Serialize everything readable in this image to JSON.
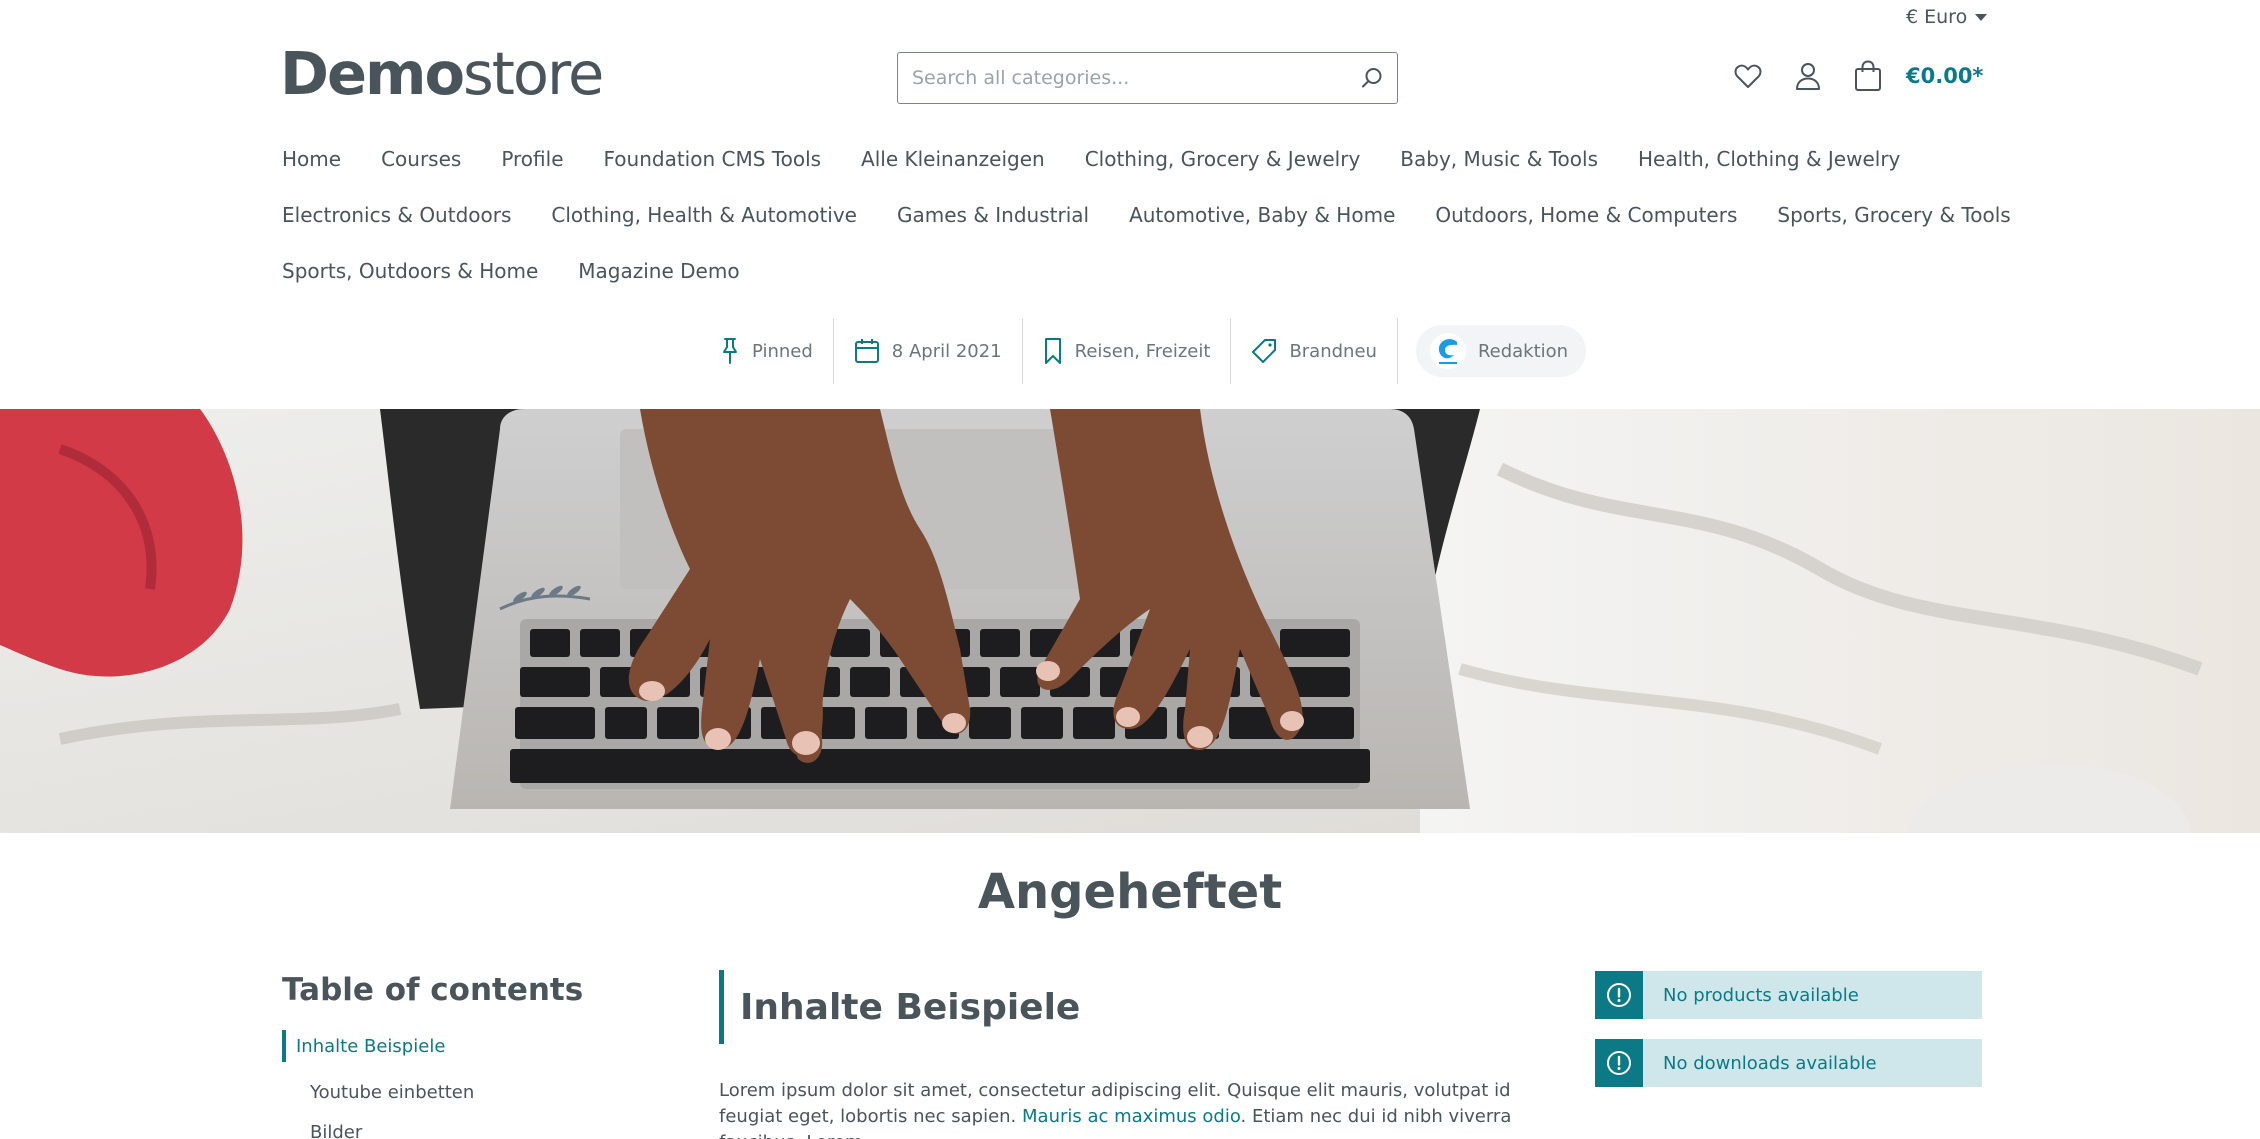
{
  "topbar": {
    "currency": "€ Euro"
  },
  "header": {
    "logo_bold": "Demo",
    "logo_light": "store",
    "search_placeholder": "Search all categories...",
    "cart_total": "€0.00*"
  },
  "nav": {
    "row1": [
      "Home",
      "Courses",
      "Profile",
      "Foundation CMS Tools",
      "Alle Kleinanzeigen",
      "Clothing, Grocery & Jewelry",
      "Baby, Music & Tools",
      "Health, Clothing & Jewelry"
    ],
    "row2": [
      "Electronics & Outdoors",
      "Clothing, Health & Automotive",
      "Games & Industrial",
      "Automotive, Baby & Home",
      "Outdoors, Home & Computers",
      "Sports, Grocery & Tools"
    ],
    "row3": [
      "Sports, Outdoors & Home",
      "Magazine Demo"
    ]
  },
  "meta": {
    "pinned": "Pinned",
    "date": "8 April 2021",
    "categories": "Reisen, Freizeit",
    "tag": "Brandneu",
    "author": "Redaktion"
  },
  "page_title": "Angeheftet",
  "toc": {
    "heading": "Table of contents",
    "items": [
      "Inhalte Beispiele",
      "Youtube einbetten",
      "Bilder"
    ]
  },
  "article": {
    "heading": "Inhalte Beispiele",
    "p_start": "Lorem ipsum dolor sit amet, consectetur adipiscing elit. Quisque elit mauris, volutpat id feugiat eget, lobortis nec sapien. ",
    "p_link": "Mauris ac maximus odio",
    "p_end": ". Etiam nec dui id nibh viverra faucibus. Lorem"
  },
  "alerts": [
    "No products available",
    "No downloads available"
  ],
  "colors": {
    "accent": "#0b7a86",
    "text": "#4a545b",
    "alert_bg": "#cfe7ea"
  }
}
